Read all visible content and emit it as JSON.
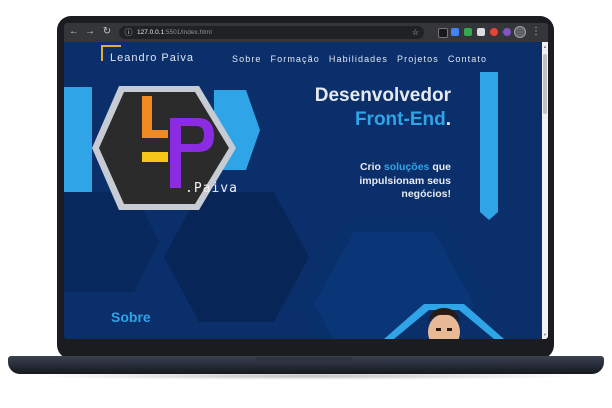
{
  "browser": {
    "url_host": "127.0.0.1",
    "url_rest": ":5501/index.html",
    "back_icon": "arrow-left-icon",
    "forward_icon": "arrow-right-icon",
    "reload_icon": "reload-icon"
  },
  "site": {
    "brand": "Leandro Paiva",
    "nav": [
      "Sobre",
      "Formação",
      "Habilidades",
      "Projetos",
      "Contato"
    ],
    "logo_text": ".Paiva"
  },
  "hero": {
    "title": "Desenvolvedor",
    "subtitle": "Front-End",
    "subtitle_dot": ".",
    "tagline_pre": "Crio ",
    "tagline_highlight": "soluções",
    "tagline_post": " que impulsionam seus negócios!"
  },
  "section": {
    "sobre_heading": "Sobre"
  },
  "colors": {
    "page_bg": "#0a2f6b",
    "accent_cyan": "#2fa4e7",
    "logo_orange": "#f08a24",
    "logo_purple": "#8b2be2",
    "logo_yellow": "#f5c518"
  }
}
